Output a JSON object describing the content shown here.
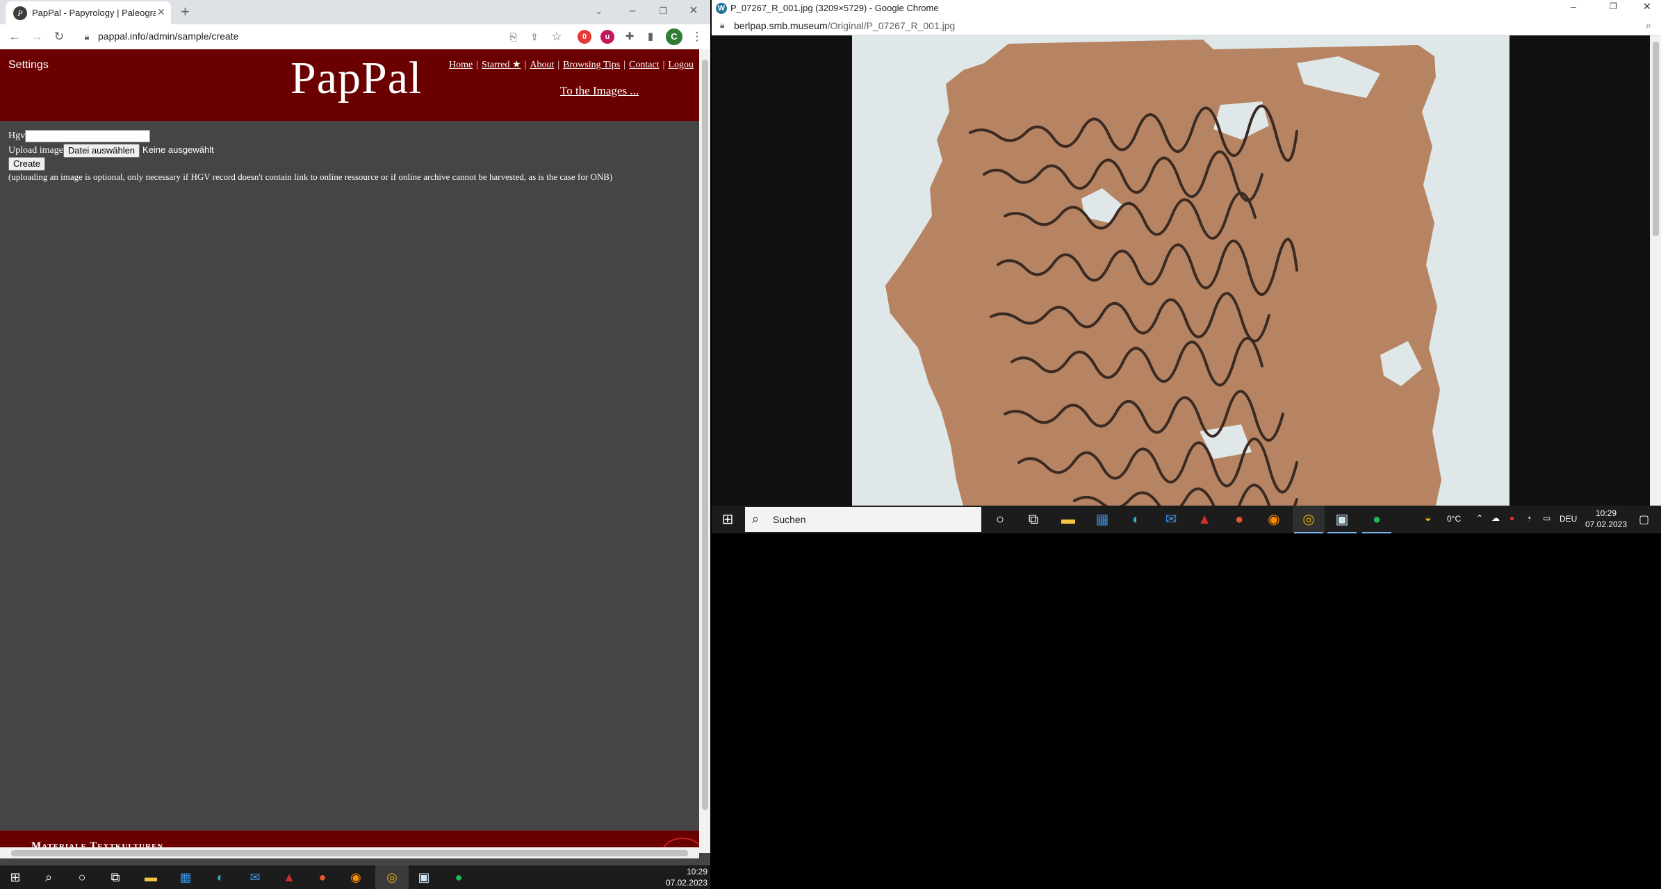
{
  "left_browser": {
    "tab_title": "PapPal - Papyrology | Paleograph",
    "url": "pappal.info/admin/sample/create",
    "profile_initial": "C"
  },
  "pappal": {
    "settings_label": "Settings",
    "logo": "PapPal",
    "nav": [
      "Home",
      "Starred ★",
      "About",
      "Browsing Tips",
      "Contact",
      "Logou"
    ],
    "to_images": "To the Images ...",
    "form": {
      "hgv_label": "Hgv",
      "hgv_value": "",
      "upload_label": "Upload image",
      "file_button": "Datei auswählen",
      "file_status": "Keine ausgewählt",
      "create_button": "Create",
      "note": "(uploading an image is optional, only necessary if HGV record doesn't contain link to online ressource or if online archive cannot be harvested, as is the case for ONB)"
    },
    "footer_text": "Materiale Textkulturen"
  },
  "right_browser": {
    "title": "P_07267_R_001.jpg (3209×5729) - Google Chrome",
    "url_host": "berlpap.smb.museum",
    "url_path": "/Original/P_07267_R_001.jpg"
  },
  "right_taskbar": {
    "search_placeholder": "Suchen",
    "weather": "0°C",
    "lang": "DEU",
    "time": "10:29",
    "date": "07.02.2023"
  },
  "left_taskbar": {
    "time": "10:29",
    "date": "07.02.2023"
  },
  "colors": {
    "pappal_header": "#6b0000",
    "pappal_body": "#454545",
    "papyrus": "#b78463",
    "ink": "#3a2a22"
  }
}
